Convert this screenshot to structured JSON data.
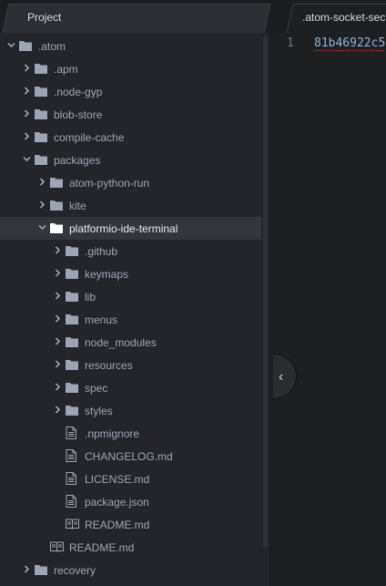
{
  "tabs": {
    "project_label": "Project",
    "editor_label": ".atom-socket-sec"
  },
  "editor": {
    "line_number": "1",
    "code_text": "81b46922c5"
  },
  "tree": [
    {
      "label": ".atom",
      "kind": "folder",
      "expanded": true,
      "depth": 0
    },
    {
      "label": ".apm",
      "kind": "folder",
      "expanded": false,
      "depth": 1
    },
    {
      "label": ".node-gyp",
      "kind": "folder",
      "expanded": false,
      "depth": 1
    },
    {
      "label": "blob-store",
      "kind": "folder",
      "expanded": false,
      "depth": 1
    },
    {
      "label": "compile-cache",
      "kind": "folder",
      "expanded": false,
      "depth": 1
    },
    {
      "label": "packages",
      "kind": "folder",
      "expanded": true,
      "depth": 1
    },
    {
      "label": "atom-python-run",
      "kind": "folder",
      "expanded": false,
      "depth": 2
    },
    {
      "label": "kite",
      "kind": "folder",
      "expanded": false,
      "depth": 2
    },
    {
      "label": "platformio-ide-terminal",
      "kind": "folder",
      "expanded": true,
      "depth": 2,
      "selected": true
    },
    {
      "label": ".github",
      "kind": "folder",
      "expanded": false,
      "depth": 3
    },
    {
      "label": "keymaps",
      "kind": "folder",
      "expanded": false,
      "depth": 3
    },
    {
      "label": "lib",
      "kind": "folder",
      "expanded": false,
      "depth": 3
    },
    {
      "label": "menus",
      "kind": "folder",
      "expanded": false,
      "depth": 3
    },
    {
      "label": "node_modules",
      "kind": "folder",
      "expanded": false,
      "depth": 3
    },
    {
      "label": "resources",
      "kind": "folder",
      "expanded": false,
      "depth": 3
    },
    {
      "label": "spec",
      "kind": "folder",
      "expanded": false,
      "depth": 3
    },
    {
      "label": "styles",
      "kind": "folder",
      "expanded": false,
      "depth": 3
    },
    {
      "label": ".npmignore",
      "kind": "file",
      "depth": 3
    },
    {
      "label": "CHANGELOG.md",
      "kind": "file",
      "depth": 3
    },
    {
      "label": "LICENSE.md",
      "kind": "file",
      "depth": 3
    },
    {
      "label": "package.json",
      "kind": "file",
      "depth": 3
    },
    {
      "label": "README.md",
      "kind": "book",
      "depth": 3
    },
    {
      "label": "README.md",
      "kind": "book",
      "depth": 2
    },
    {
      "label": "recovery",
      "kind": "folder",
      "expanded": false,
      "depth": 1
    }
  ]
}
